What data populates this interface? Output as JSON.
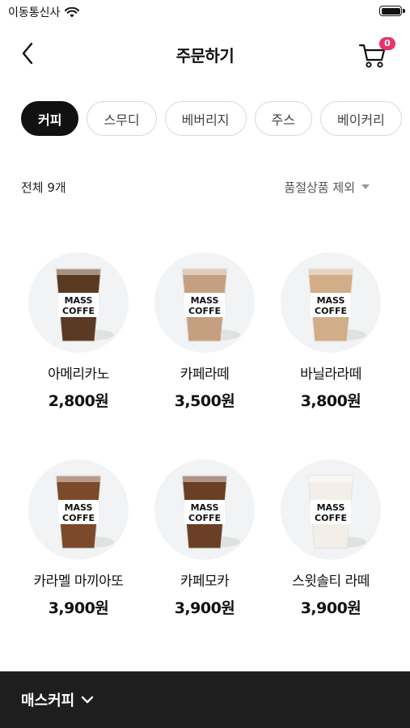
{
  "status_bar": {
    "carrier": "이동통신사"
  },
  "header": {
    "title": "주문하기",
    "cart_count": "0"
  },
  "tabs": [
    {
      "label": "커피",
      "active": true
    },
    {
      "label": "스무디",
      "active": false
    },
    {
      "label": "베버리지",
      "active": false
    },
    {
      "label": "주스",
      "active": false
    },
    {
      "label": "베이커리",
      "active": false
    }
  ],
  "filter": {
    "total": "전체 9개",
    "sort_label": "품절상품 제외"
  },
  "products": [
    {
      "name": "아메리카노",
      "price": "2,800원",
      "liquid": "#5a3a22",
      "cup_text": "MASS COFFE"
    },
    {
      "name": "카페라떼",
      "price": "3,500원",
      "liquid": "#c4a081",
      "cup_text": "MASS COFFE"
    },
    {
      "name": "바닐라라떼",
      "price": "3,800원",
      "liquid": "#d1ad88",
      "cup_text": "MASS COFFE"
    },
    {
      "name": "카라멜 마끼아또",
      "price": "3,900원",
      "liquid": "#7a4a2a",
      "cup_text": "MASS COFFE"
    },
    {
      "name": "카페모카",
      "price": "3,900원",
      "liquid": "#6b3f26",
      "cup_text": "MASS COFFE"
    },
    {
      "name": "스윗솔티 라떼",
      "price": "3,900원",
      "liquid": "#f3efe8",
      "cup_text": "MASS COFFE"
    }
  ],
  "bottom_bar": {
    "store_name": "매스커피"
  }
}
